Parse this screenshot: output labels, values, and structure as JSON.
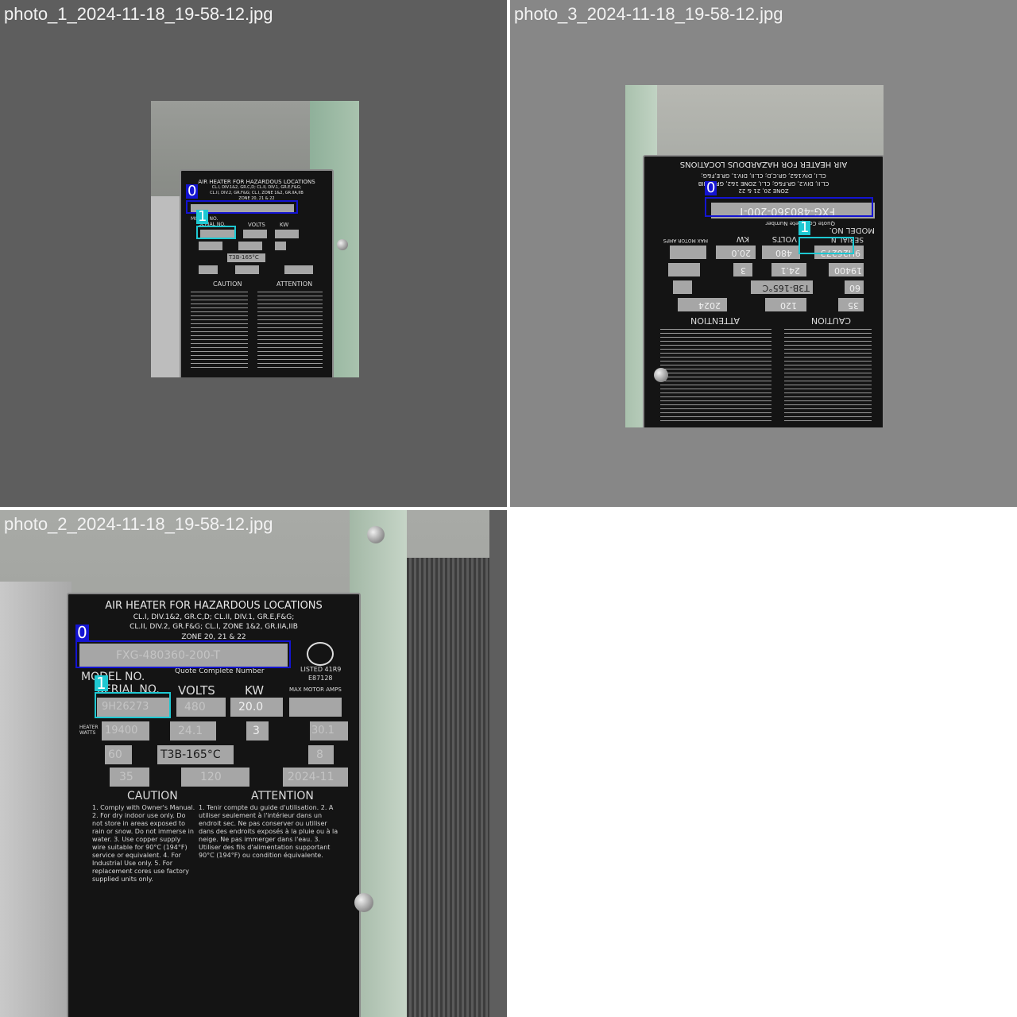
{
  "tiles": [
    {
      "title": "photo_1_2024-11-18_19-58-12.jpg",
      "plate": {
        "heading": "AIR HEATER FOR HAZARDOUS LOCATIONS",
        "class_line1": "CL.I, DIV.1&2, GR.C,D; CL.II, DIV.1, GR.E,F&G;",
        "class_line2": "CL.II, DIV.2, GR.F&G; CL.I, ZONE 1&2, GR.IIA,IIB",
        "zone": "ZONE 20, 21 & 22",
        "model_label": "MODEL NO.",
        "serial_label": "SERIAL NO.",
        "volts_label": "VOLTS",
        "kw_label": "KW",
        "caution": "CAUTION",
        "attention": "ATTENTION",
        "temp_code": "T3B-165°C"
      },
      "detections": [
        {
          "class_id": "0",
          "color": "#1414d2"
        },
        {
          "class_id": "1",
          "color": "#1ec8d2"
        }
      ]
    },
    {
      "title": "photo_3_2024-11-18_19-58-12.jpg",
      "plate": {
        "heading": "AIR HEATER FOR HAZARDOUS LOCATIONS",
        "class_line1": "CL.I, DIV.1&2, GR.C,D; CL.II, DIV.1, GR.E,F&G;",
        "class_line2": "CL.II, DIV.2, GR.F&G; CL.I, ZONE 1&2, GR.IIA,IIB",
        "zone": "ZONE 20, 21 & 22",
        "model_value": "FXG-480360-200-T",
        "quote": "Quote Complete Number",
        "model_label": "MODEL NO.",
        "serial_label": "SERIAL N",
        "serial_value": "9H26273",
        "volts_label": "VOLTS",
        "kw_label": "KW",
        "max_motor_amps": "MAX MOTOR AMPS",
        "volts_value": "480",
        "kw_value": "20.0",
        "heater_watts": "19400",
        "line_amps": "24.1",
        "phase": "3",
        "hertz": "60",
        "temp_code": "T3B-165°C",
        "control_voltage": "120",
        "max_fuse": "35",
        "date": "2024",
        "caution": "CAUTION",
        "attention": "ATTENTION"
      },
      "detections": [
        {
          "class_id": "0",
          "color": "#1414d2"
        },
        {
          "class_id": "1",
          "color": "#1ec8d2"
        }
      ]
    },
    {
      "title": "photo_2_2024-11-18_19-58-12.jpg",
      "plate": {
        "heading": "AIR HEATER FOR HAZARDOUS LOCATIONS",
        "class_line1": "CL.I, DIV.1&2, GR.C,D; CL.II, DIV.1, GR.E,F&G;",
        "class_line2": "CL.II, DIV.2, GR.F&G; CL.I, ZONE 1&2, GR.IIA,IIB",
        "zone": "ZONE 20, 21 & 22",
        "model_value": "FXG-480360-200-T",
        "quote": "Quote Complete Number",
        "model_label": "MODEL NO.",
        "serial_label": "SERIAL NO.",
        "serial_value": "9H26273",
        "volts_label": "VOLTS",
        "kw_label": "KW",
        "max_motor_amps": "MAX MOTOR AMPS",
        "volts_value": "480",
        "kw_value": "20.0",
        "heater_watts": "19400",
        "line_amps": "24.1",
        "phase": "3",
        "min_circuit": "30.1",
        "hertz": "60",
        "temp_code": "T3B-165°C",
        "wire_awg": "8",
        "max_fuse": "35",
        "control_voltage": "120",
        "date": "2024-11",
        "listed": "LISTED 41R9",
        "listed_no": "E87128",
        "caution": "CAUTION",
        "attention": "ATTENTION",
        "caution_text": "1. Comply with Owner's Manual. 2. For dry indoor use only. Do not store in areas exposed to rain or snow. Do not immerse in water. 3. Use copper supply wire suitable for 90°C (194°F) service or equivalent. 4. For Industrial Use only. 5. For replacement cores use factory supplied units only.",
        "attention_text": "1. Tenir compte du guide d'utilisation. 2. A utiliser seulement à l'intérieur dans un endroit sec. Ne pas conserver ou utiliser dans des endroits exposés à la pluie ou à la neige. Ne pas immerger dans l'eau. 3. Utiliser des fils d'alimentation supportant 90°C (194°F) ou condition équivalente."
      },
      "detections": [
        {
          "class_id": "0",
          "color": "#1414d2"
        },
        {
          "class_id": "1",
          "color": "#1ec8d2"
        }
      ]
    }
  ]
}
